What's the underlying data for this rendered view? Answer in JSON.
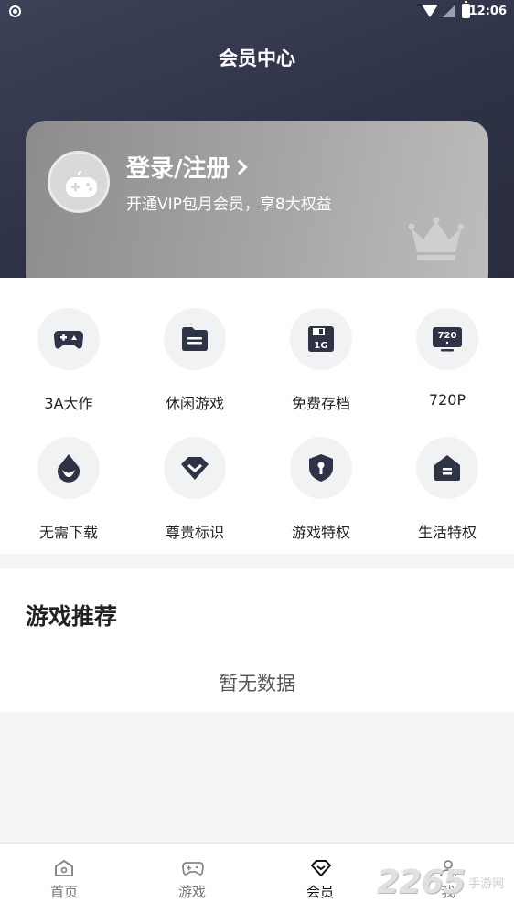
{
  "status_bar": {
    "time": "12:06"
  },
  "page_title": "会员中心",
  "member_card": {
    "login_label": "登录/注册",
    "vip_text": "开通VIP包月会员，享8大权益"
  },
  "privileges": [
    {
      "label": "3A大作",
      "icon": "gamepad-icon"
    },
    {
      "label": "休闲游戏",
      "icon": "folder-icon"
    },
    {
      "label": "免费存档",
      "icon": "save-disk-icon",
      "badge": "1G"
    },
    {
      "label": "720P",
      "icon": "monitor-720-icon",
      "badge": "720"
    },
    {
      "label": "无需下载",
      "icon": "drop-icon"
    },
    {
      "label": "尊贵标识",
      "icon": "diamond-icon"
    },
    {
      "label": "游戏特权",
      "icon": "shield-key-icon"
    },
    {
      "label": "生活特权",
      "icon": "house-icon"
    }
  ],
  "recommend": {
    "title": "游戏推荐",
    "empty_text": "暂无数据"
  },
  "bottom_nav": [
    {
      "label": "首页",
      "icon": "home-icon"
    },
    {
      "label": "游戏",
      "icon": "gamepad-icon"
    },
    {
      "label": "会员",
      "icon": "diamond-icon",
      "active": true
    },
    {
      "label": "我",
      "icon": "user-icon"
    }
  ],
  "watermark": {
    "number": "2265",
    "site": "手游网"
  },
  "colors": {
    "header_bg": "#2e3246",
    "icon_fg": "#2f3346",
    "active_nav": "#111111"
  }
}
